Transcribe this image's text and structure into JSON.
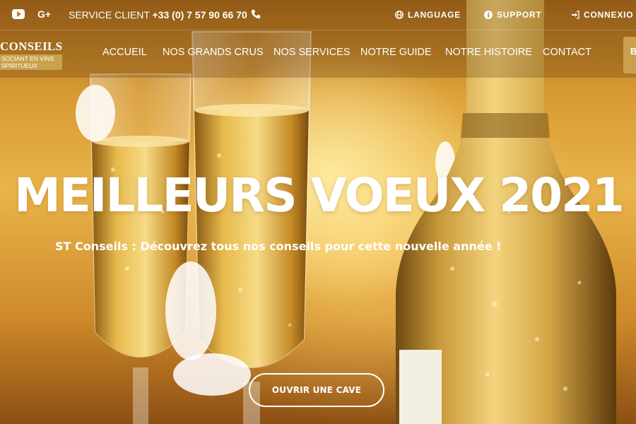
{
  "topbar": {
    "social": [
      {
        "icon": "youtube-icon"
      },
      {
        "icon": "google-plus-icon",
        "label": "G+"
      }
    ],
    "service_label": "SERVICE CLIENT",
    "service_phone": "+33 (0) 7 57 90 66 70",
    "phone_icon": "phone-icon",
    "language_label": "LANGUAGE",
    "support_label": "SUPPORT",
    "login_label": "CONNEXIO"
  },
  "logo": {
    "title": "CONSEILS",
    "subtitle_line1": "SOCIANT EN VINS",
    "subtitle_line2": "SPIRITUEUX"
  },
  "nav": {
    "items": [
      {
        "label": "ACCUEIL"
      },
      {
        "label": "NOS GRANDS CRUS"
      },
      {
        "label": "NOS SERVICES"
      },
      {
        "label": "NOTRE GUIDE"
      },
      {
        "label": "NOTRE HISTOIRE"
      },
      {
        "label": "CONTACT"
      }
    ],
    "cta_label": "B"
  },
  "hero": {
    "title": "MEILLEURS VOEUX 2021",
    "subtitle": "ST Conseils : Découvrez tous nos conseils pour cette nouvelle année !",
    "button_label": "OUVRIR UNE CAVE"
  },
  "colors": {
    "accent": "#c9a24d",
    "text": "#ffffff"
  }
}
